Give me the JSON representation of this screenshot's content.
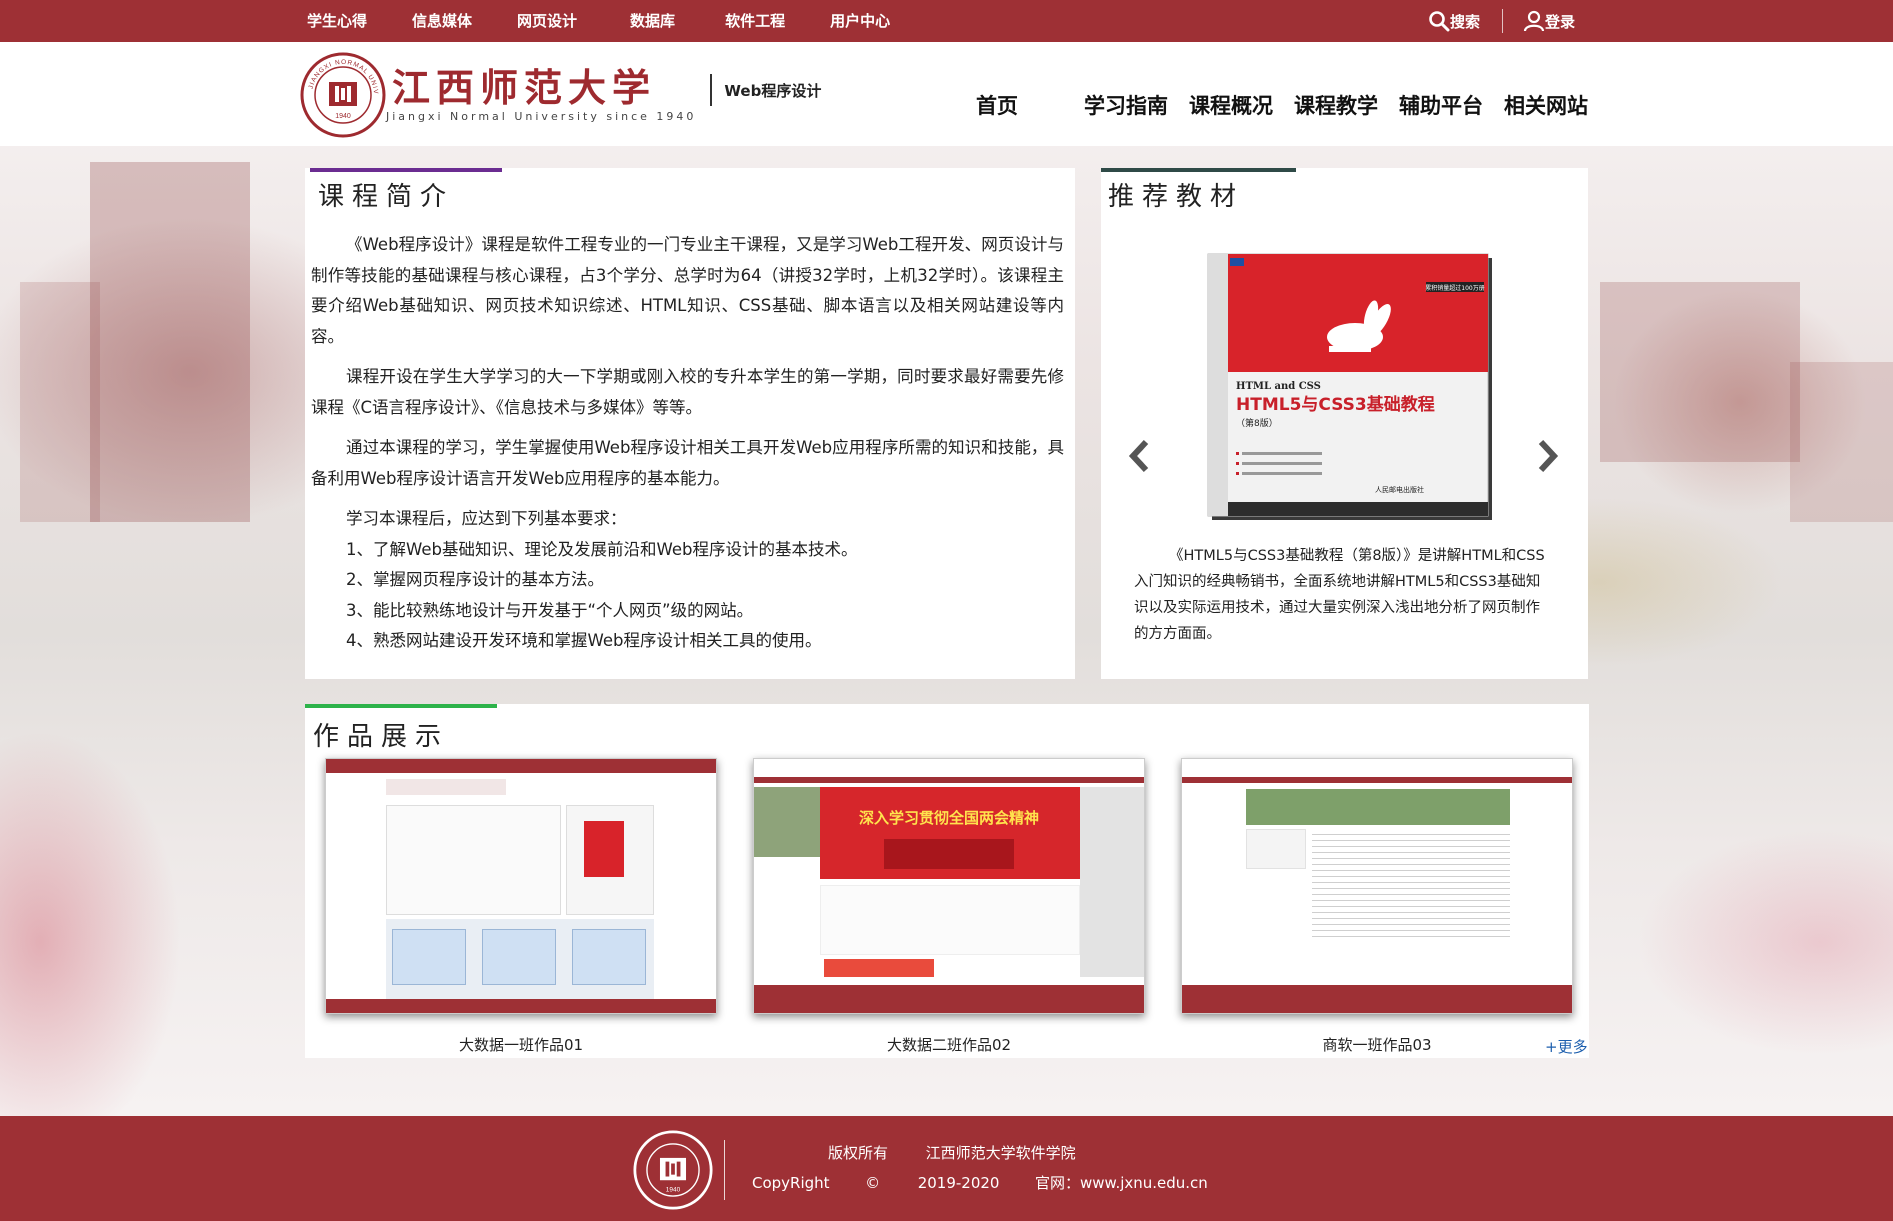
{
  "colors": {
    "brand": "#9e3035",
    "intro_accent": "#6b2c91",
    "book_accent": "#2f4a47",
    "works_accent": "#2db34a",
    "link": "#1d5fae"
  },
  "topbar": {
    "nav": [
      {
        "label": "学生心得"
      },
      {
        "label": "信息媒体"
      },
      {
        "label": "网页设计"
      },
      {
        "label": "数据库"
      },
      {
        "label": "软件工程"
      },
      {
        "label": "用户中心"
      }
    ],
    "search_label": "搜索",
    "login_label": "登录",
    "search_icon": "search-icon",
    "user_icon": "user-icon"
  },
  "header": {
    "school_cn": "江西师范大学",
    "school_en": "Jiangxi Normal University since 1940",
    "site_name": "Web程序设计",
    "seal_text": "JIANGXI NORMAL UNIVERSITY",
    "seal_year": "1940",
    "nav": [
      {
        "label": "首页"
      },
      {
        "label": "学习指南"
      },
      {
        "label": "课程概况"
      },
      {
        "label": "课程教学"
      },
      {
        "label": "辅助平台"
      },
      {
        "label": "相关网站"
      }
    ]
  },
  "intro": {
    "title": "课程简介",
    "paragraphs": [
      "《Web程序设计》课程是软件工程专业的一门专业主干课程，又是学习Web工程开发、网页设计与制作等技能的基础课程与核心课程，占3个学分、总学时为64（讲授32学时，上机32学时）。该课程主要介绍Web基础知识、网页技术知识综述、HTML知识、CSS基础、脚本语言以及相关网站建设等内容。",
      "课程开设在学生大学学习的大一下学期或刚入校的专升本学生的第一学期，同时要求最好需要先修课程《C语言程序设计》、《信息技术与多媒体》等等。",
      "通过本课程的学习，学生掌握使用Web程序设计相关工具开发Web应用程序所需的知识和技能，具备利用Web程序设计语言开发Web应用程序的基本能力。"
    ],
    "requirements_heading": "学习本课程后，应达到下列基本要求：",
    "requirements": [
      "1、了解Web基础知识、理论及发展前沿和Web程序设计的基本技术。",
      "2、掌握网页程序设计的基本方法。",
      "3、能比较熟练地设计与开发基于“个人网页”级的网站。",
      "4、熟悉网站建设开发环境和掌握Web程序设计相关工具的使用。"
    ]
  },
  "books": {
    "title": "推荐教材",
    "prev_icon": "chevron-left-icon",
    "next_icon": "chevron-right-icon",
    "current": {
      "cover_title_en": "HTML and CSS",
      "cover_title_cn": "HTML5与CSS3基础教程",
      "cover_edition": "（第8版）",
      "cover_publisher": "人民邮电出版社",
      "cover_badge": "累积销量超过100万册",
      "description": "《HTML5与CSS3基础教程（第8版）》是讲解HTML和CSS入门知识的经典畅销书，全面系统地讲解HTML5和CSS3基础知识以及实际运用技术，通过大量实例深入浅出地分析了网页制作的方方面面。"
    }
  },
  "works": {
    "title": "作品展示",
    "items": [
      {
        "caption": "大数据一班作品01",
        "banner": ""
      },
      {
        "caption": "大数据二班作品02",
        "banner": "深入学习贯彻全国两会精神"
      },
      {
        "caption": "商软一班作品03",
        "banner": ""
      }
    ],
    "more_label": "+更多"
  },
  "footer": {
    "copyright_label": "版权所有",
    "org": "江西师范大学软件学院",
    "copyright_en": "CopyRight",
    "copyright_symbol": "©",
    "years": "2019-2020",
    "site_label": "官网：www.jxnu.edu.cn"
  }
}
